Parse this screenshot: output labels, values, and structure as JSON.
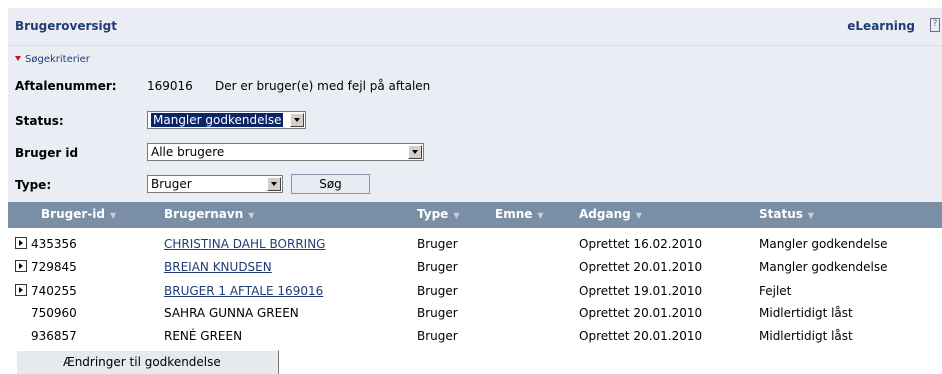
{
  "header": {
    "title": "Brugeroversigt",
    "elearning_label": "eLearning",
    "help_icon": "help-icon"
  },
  "filters": {
    "toggle_label": "Søgekriterier",
    "agreement_label": "Aftalenummer:",
    "agreement_number": "169016",
    "agreement_message": "Der er bruger(e) med fejl på aftalen",
    "status_label": "Status:",
    "status_value": "Mangler godkendelse",
    "user_id_label": "Bruger id",
    "user_id_value": "Alle brugere",
    "type_label": "Type:",
    "type_value": "Bruger",
    "search_button": "Søg"
  },
  "table": {
    "columns": [
      "Bruger-id",
      "Brugernavn",
      "Type",
      "Emne",
      "Adgang",
      "Status"
    ],
    "rows": [
      {
        "id": "435356",
        "name": "CHRISTINA DAHL BORRING",
        "type": "Bruger",
        "emne": "",
        "adgang": "Oprettet 16.02.2010",
        "status": "Mangler godkendelse",
        "expandable": true,
        "link": true
      },
      {
        "id": "729845",
        "name": "BREIAN KNUDSEN",
        "type": "Bruger",
        "emne": "",
        "adgang": "Oprettet 20.01.2010",
        "status": "Mangler godkendelse",
        "expandable": true,
        "link": true
      },
      {
        "id": "740255",
        "name": "BRUGER 1 AFTALE 169016",
        "type": "Bruger",
        "emne": "",
        "adgang": "Oprettet 19.01.2010",
        "status": "Fejlet",
        "expandable": true,
        "link": true
      },
      {
        "id": "750960",
        "name": "SAHRA GUNNA GREEN",
        "type": "Bruger",
        "emne": "",
        "adgang": "Oprettet 20.01.2010",
        "status": "Midlertidigt låst",
        "expandable": false,
        "link": false
      },
      {
        "id": "936857",
        "name": "RENÉ GREEN",
        "type": "Bruger",
        "emne": "",
        "adgang": "Oprettet 20.01.2010",
        "status": "Midlertidigt låst",
        "expandable": false,
        "link": false
      }
    ]
  },
  "footer": {
    "submit_button": "Ændringer til godkendelse"
  },
  "colors": {
    "accent": "#1f3d75",
    "header_bg": "#eaeef4",
    "table_header_bg": "#7a8ea6",
    "error_arrow": "#c8102e"
  }
}
